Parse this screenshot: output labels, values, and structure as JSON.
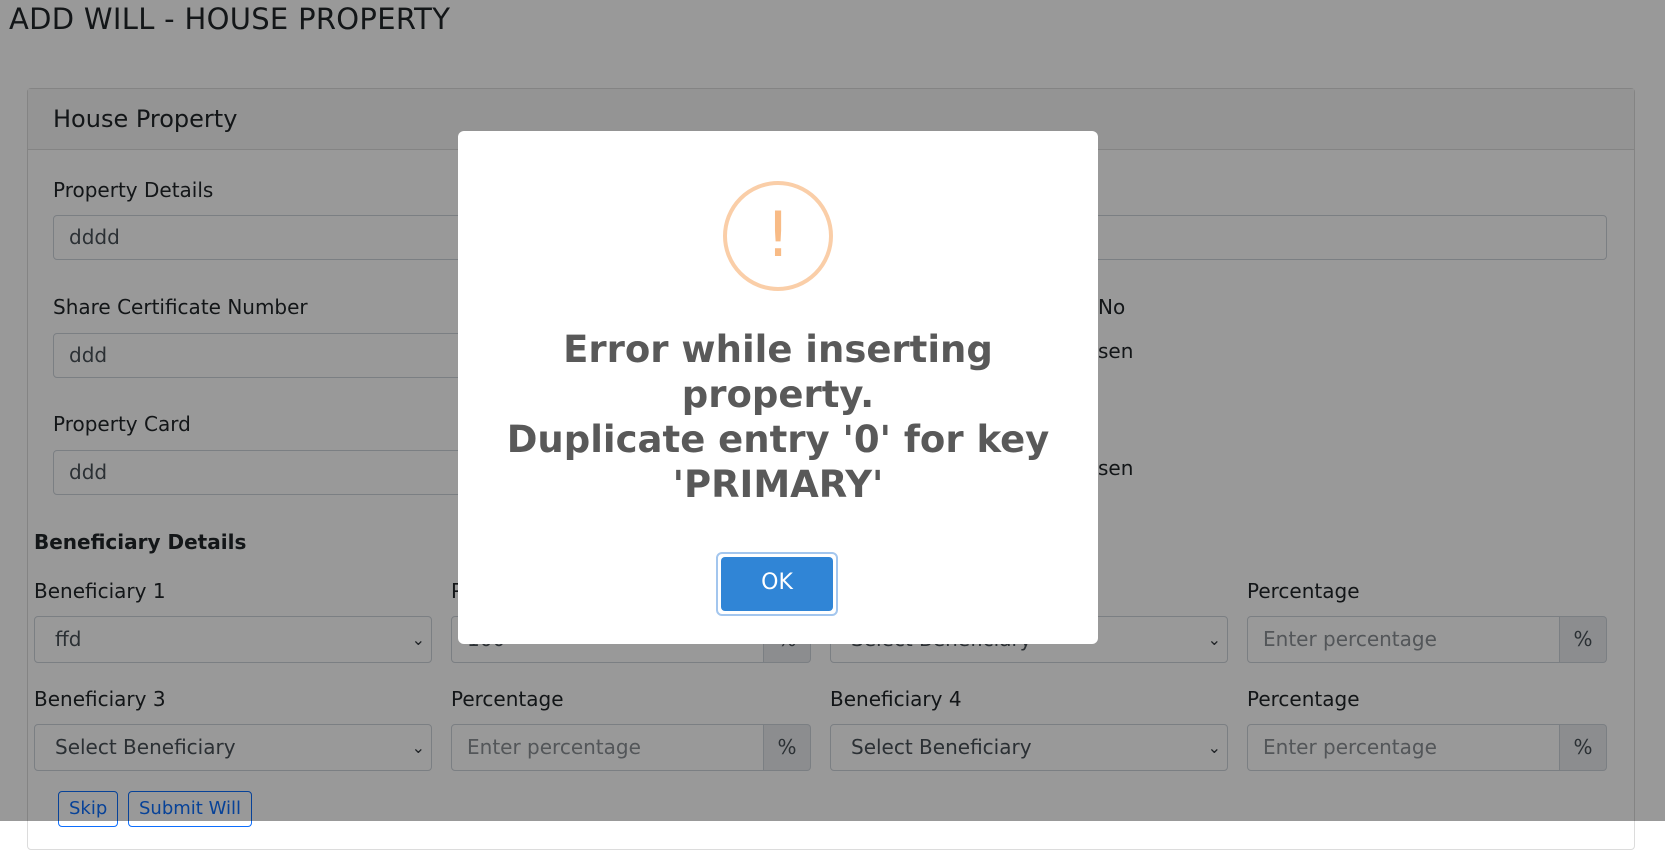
{
  "page": {
    "title": "ADD WILL - HOUSE PROPERTY"
  },
  "card": {
    "title": "House Property"
  },
  "form": {
    "property_details_label": "Property Details",
    "property_details_value": "dddd",
    "share_certificate_label": "Share Certificate Number",
    "share_certificate_value": "ddd",
    "right_label_partial": "No",
    "radio_text_1_partial": "sen",
    "property_card_label": "Property Card",
    "property_card_value": "ddd",
    "radio_text_2_partial": "sen"
  },
  "beneficiary": {
    "section_title": "Beneficiary Details",
    "b1_label": "Beneficiary 1",
    "b1_value": "ffd",
    "p1_label_partial": "P",
    "p1_value_partial": "100",
    "b2_value_partial": "Select Beneficiary",
    "p2_label": "Percentage",
    "p2_placeholder": "Enter percentage",
    "b3_label": "Beneficiary 3",
    "b3_value": "Select Beneficiary",
    "p3_label": "Percentage",
    "p3_placeholder": "Enter percentage",
    "b4_label": "Beneficiary 4",
    "b4_value": "Select Beneficiary",
    "p4_label": "Percentage",
    "p4_placeholder": "Enter percentage",
    "percent_symbol": "%",
    "chevron_icon": "chevron-down-icon"
  },
  "actions": {
    "skip_label": "Skip",
    "submit_label": "Submit Will"
  },
  "modal": {
    "icon": "warning-icon",
    "icon_glyph": "!",
    "message_lines": [
      "Error while inserting",
      "property.",
      "Duplicate entry '0' for key",
      "'PRIMARY'"
    ],
    "ok_label": "OK",
    "colors": {
      "ring": "#facea8",
      "mark": "#f8bb86",
      "confirm": "#3085d6",
      "text": "#595959"
    }
  }
}
